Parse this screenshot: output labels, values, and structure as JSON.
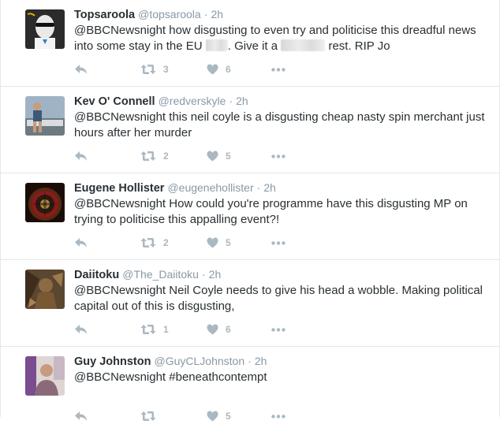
{
  "tweets": [
    {
      "name": "Topsaroola",
      "handle": "@topsaroola",
      "sep": "·",
      "time": "2h",
      "mention": "@BBCNewsnight",
      "text_a": " how disgusting to even try and politicise this dreadful news into some stay in the EU ",
      "text_b": ". Give it a ",
      "text_c": " rest. RIP Jo",
      "retweets": "3",
      "likes": "6"
    },
    {
      "name": "Kev O' Connell",
      "handle": "@redverskyle",
      "sep": "·",
      "time": "2h",
      "mention": "@BBCNewsnight",
      "text": " this neil coyle is a disgusting cheap nasty spin merchant just hours after her murder",
      "retweets": "2",
      "likes": "5"
    },
    {
      "name": "Eugene Hollister",
      "handle": "@eugenehollister",
      "sep": "·",
      "time": "2h",
      "mention": "@BBCNewsnight",
      "text": " How could you're programme have this disgusting MP on trying to politicise this appalling event?!",
      "retweets": "2",
      "likes": "5"
    },
    {
      "name": "Daiitoku",
      "handle": "@The_Daiitoku",
      "sep": "·",
      "time": "2h",
      "mention": "@BBCNewsnight",
      "text": " Neil Coyle needs to give his head a wobble. Making political capital out of this is disgusting,",
      "retweets": "1",
      "likes": "6"
    },
    {
      "name": "Guy Johnston",
      "handle": "@GuyCLJohnston",
      "sep": "·",
      "time": "2h",
      "mention": "@BBCNewsnight",
      "text": " #beneathcontempt",
      "retweets": "",
      "likes": "5"
    }
  ],
  "colors": {
    "text": "#292f33",
    "meta": "#8899a6",
    "icon": "#aab8c2",
    "divider": "#e1e8ed"
  },
  "icons": [
    "reply-icon",
    "retweet-icon",
    "heart-icon",
    "more-icon"
  ]
}
